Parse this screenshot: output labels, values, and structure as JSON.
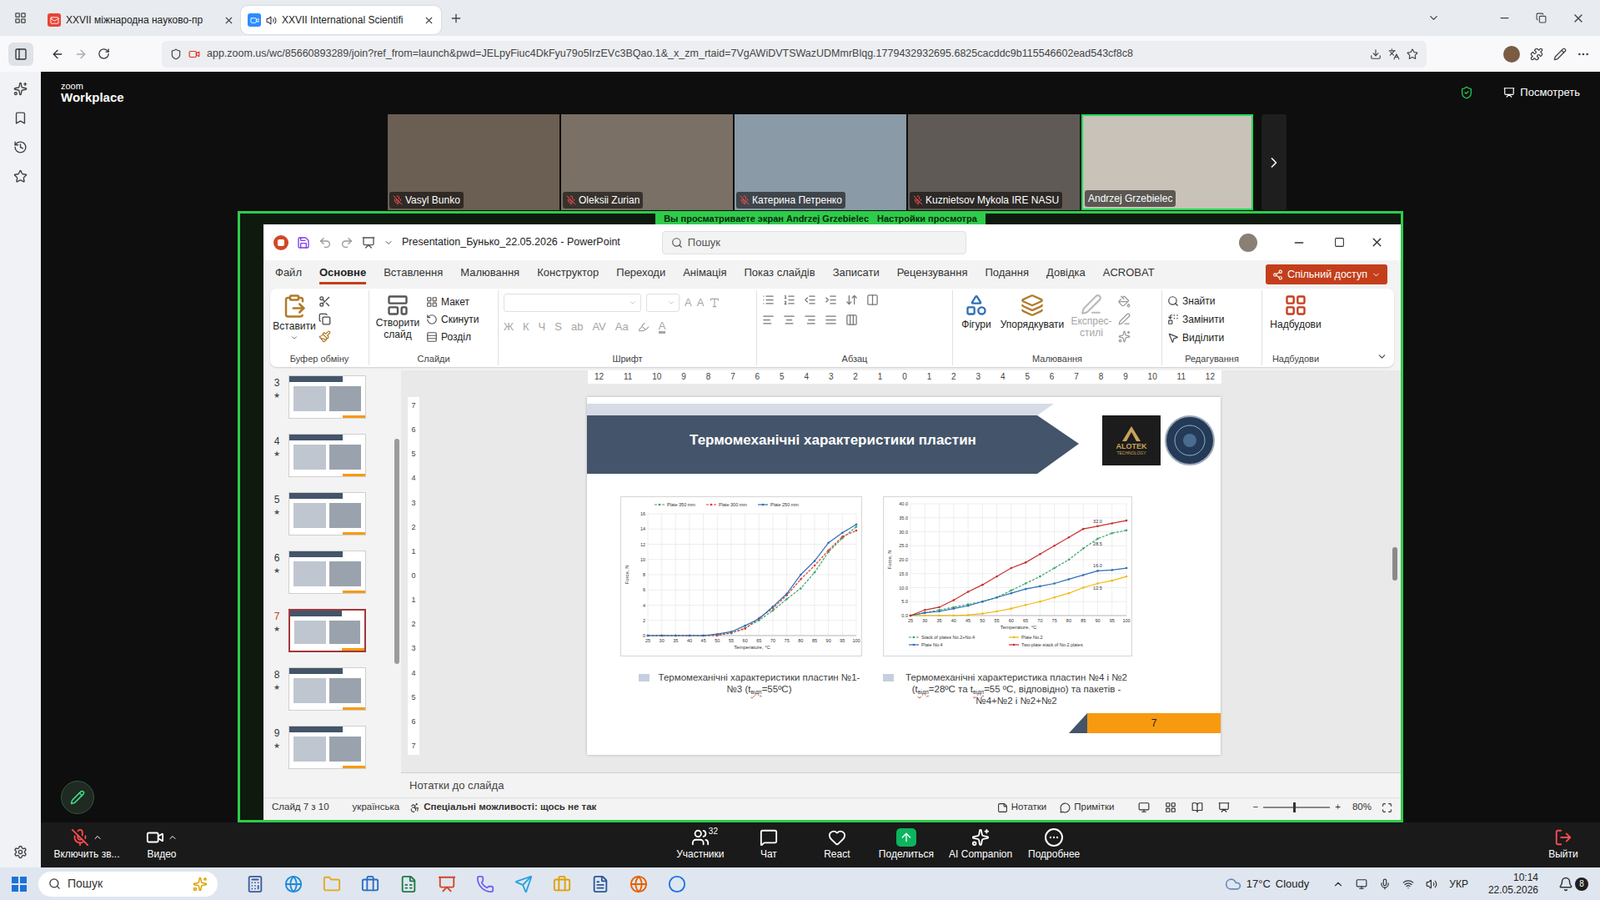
{
  "browser": {
    "tabs": [
      {
        "label": "XXVII міжнародна науково-пр",
        "selected": false,
        "color": "#ea4335",
        "audio": false
      },
      {
        "label": "XXVII International Scientifi",
        "selected": true,
        "color": "#2d8cff",
        "audio": true
      }
    ],
    "url": "app.zoom.us/wc/85660893289/join?ref_from=launch&pwd=JELpyFiuc4DkFyu79o5IrzEVc3BQao.1&_x_zm_rtaid=7VgAWiDVTSWazUDMmrBlqg.1779432932695.6825cacddc9b115546602ead543cf8c8"
  },
  "zoom": {
    "brand": "zoom",
    "product": "Workplace",
    "view_label": "Посмотреть",
    "participants": [
      {
        "name": "Vasyl Bunko",
        "muted": true,
        "active": false
      },
      {
        "name": "Oleksii Zurian",
        "muted": true,
        "active": false
      },
      {
        "name": "Катерина Петренко",
        "muted": true,
        "active": false
      },
      {
        "name": "Kuznietsov Mykola IRE NASU",
        "muted": true,
        "active": false
      },
      {
        "name": "Andrzej Grzebielec",
        "muted": false,
        "active": true
      }
    ],
    "banner": {
      "text": "Вы просматриваете экран  Andrzej Grzebielec",
      "settings": "Настройки просмотра"
    },
    "toolbar": {
      "mic": {
        "label": "Включить зв...",
        "muted": true
      },
      "video": {
        "label": "Видео"
      },
      "center": [
        {
          "label": "Участники",
          "kind": "participants",
          "badge": "32"
        },
        {
          "label": "Чат",
          "kind": "chat",
          "badge": ""
        },
        {
          "label": "React",
          "kind": "react",
          "badge": ""
        },
        {
          "label": "Поделиться",
          "kind": "share",
          "badge": ""
        },
        {
          "label": "AI Companion",
          "kind": "ai",
          "badge": ""
        },
        {
          "label": "Подробнее",
          "kind": "more",
          "badge": ""
        }
      ],
      "exit": "Выйти"
    }
  },
  "powerpoint": {
    "title": "Presentation_Бунько_22.05.2026  -  PowerPoint",
    "search": "Пошук",
    "tabs": [
      {
        "label": "Файл",
        "selected": false
      },
      {
        "label": "Основне",
        "selected": true
      },
      {
        "label": "Вставлення",
        "selected": false
      },
      {
        "label": "Малювання",
        "selected": false
      },
      {
        "label": "Конструктор",
        "selected": false
      },
      {
        "label": "Переходи",
        "selected": false
      },
      {
        "label": "Анімація",
        "selected": false
      },
      {
        "label": "Показ слайдів",
        "selected": false
      },
      {
        "label": "Записати",
        "selected": false
      },
      {
        "label": "Рецензування",
        "selected": false
      },
      {
        "label": "Подання",
        "selected": false
      },
      {
        "label": "Довідка",
        "selected": false
      },
      {
        "label": "ACROBAT",
        "selected": false
      }
    ],
    "share": "Спільний доступ",
    "ribbon": {
      "clipboard": {
        "label": "Буфер обміну",
        "paste": "Вставити"
      },
      "slides": {
        "label": "Слайди",
        "new": "Створити слайд",
        "layout": "Макет",
        "reset": "Скинути",
        "section": "Розділ"
      },
      "font": {
        "label": "Шрифт",
        "disabled": true,
        "size_buttons": [
          "A",
          "A"
        ],
        "buttons": [
          "Ж",
          "К",
          "Ч",
          "S",
          "ab",
          "AV",
          "Aa"
        ],
        "color_button": "A"
      },
      "paragraph": {
        "label": "Абзац"
      },
      "drawing": {
        "label": "Малювання",
        "shapes": "Фігури",
        "arrange": "Упорядкувати",
        "styles": "Експрес-стилі",
        "styles_disabled": true
      },
      "editing": {
        "label": "Редагування",
        "find": "Знайти",
        "replace": "Замінити",
        "select": "Виділити"
      },
      "addins": {
        "label": "Надбудови",
        "button": "Надбудови"
      }
    },
    "thumbnails": [
      {
        "number": "3",
        "mark": "★",
        "selected": false
      },
      {
        "number": "4",
        "mark": "★",
        "selected": false
      },
      {
        "number": "5",
        "mark": "★",
        "selected": false
      },
      {
        "number": "6",
        "mark": "★",
        "selected": false
      },
      {
        "number": "7",
        "mark": "★",
        "selected": true
      },
      {
        "number": "8",
        "mark": "★",
        "selected": false
      },
      {
        "number": "9",
        "mark": "★",
        "selected": false
      }
    ],
    "ruler_h": [
      "12",
      "11",
      "10",
      "9",
      "8",
      "7",
      "6",
      "5",
      "4",
      "3",
      "2",
      "1",
      "0",
      "1",
      "2",
      "3",
      "4",
      "5",
      "6",
      "7",
      "8",
      "9",
      "10",
      "11",
      "12"
    ],
    "ruler_v": [
      "7",
      "6",
      "5",
      "4",
      "3",
      "2",
      "1",
      "0",
      "1",
      "2",
      "3",
      "4",
      "5",
      "6",
      "7"
    ],
    "slide": {
      "title": "Термомеханічні характеристики пластин",
      "logo": {
        "name": "ALOTEK",
        "sub": "TECHNOLOGY"
      },
      "number": "7",
      "charts": [
        {
          "legend_position": "top",
          "y_title": "Force, N",
          "x_title": "Temperature, °C",
          "y_max": 16,
          "y_ticks": [
            "0",
            "2",
            "4",
            "6",
            "8",
            "10",
            "12",
            "14",
            "16"
          ],
          "x_labels": [
            "25",
            "30",
            "35",
            "40",
            "45",
            "50",
            "55",
            "60",
            "65",
            "70",
            "75",
            "80",
            "85",
            "90",
            "95",
            "100"
          ],
          "series": [
            {
              "name": "Plate 350 mm",
              "color": "#3aa76d",
              "kind": "dashed",
              "values": [
                0,
                0,
                0,
                0,
                0,
                0.1,
                0.3,
                1.0,
                2.0,
                3.3,
                4.8,
                6.2,
                8.3,
                11.0,
                12.8,
                14.3
              ]
            },
            {
              "name": "Plate 300 mm",
              "color": "#e03c31",
              "kind": "dashed",
              "values": [
                0,
                0,
                0,
                0,
                0,
                0,
                0.4,
                0.9,
                2.3,
                3.6,
                5.3,
                7.4,
                9.2,
                11.2,
                13.0,
                13.8
              ]
            },
            {
              "name": "Plate 250 mm",
              "color": "#2e6fb5",
              "kind": "solid",
              "values": [
                0,
                0,
                0,
                0,
                0,
                0.2,
                0.5,
                1.3,
                2.2,
                3.8,
                5.5,
                8.0,
                9.8,
                12.2,
                13.5,
                14.6
              ]
            }
          ],
          "annotations": [],
          "caption": [
            {
              "text": "Термомеханічні характеристики пластин №1-№3 (t",
              "sub": false
            },
            {
              "text": "відп",
              "sub": true
            },
            {
              "text": "=55ºС)",
              "sub": false
            }
          ]
        },
        {
          "legend_position": "bottom",
          "y_title": "Force, N",
          "x_title": "Temperature, °C",
          "y_max": 40,
          "y_ticks": [
            "0.0",
            "5.0",
            "10.0",
            "15.0",
            "20.0",
            "25.0",
            "30.0",
            "35.0",
            "40.0"
          ],
          "x_labels": [
            "25",
            "30",
            "35",
            "40",
            "45",
            "50",
            "55",
            "60",
            "65",
            "70",
            "75",
            "80",
            "85",
            "90",
            "95",
            "100"
          ],
          "series": [
            {
              "name": "Stack of plates No.2+No.4",
              "color": "#3aa76d",
              "kind": "dashed",
              "values": [
                0,
                1,
                2,
                3,
                4,
                5,
                6.5,
                9,
                11.5,
                14,
                17,
                20,
                24,
                27.5,
                29.5,
                30.5
              ]
            },
            {
              "name": "Plate No.2",
              "color": "#f2b705",
              "kind": "solid",
              "values": [
                0,
                0,
                0,
                0,
                0.2,
                0.7,
                1.5,
                2.5,
                3.8,
                5,
                6.5,
                8,
                10,
                11.5,
                12.5,
                14
              ]
            },
            {
              "name": "Plate No.4",
              "color": "#2e6fb5",
              "kind": "solid",
              "values": [
                0,
                1,
                1.5,
                2.5,
                3.5,
                5,
                6.5,
                8,
                9.5,
                10.5,
                11.5,
                13,
                14.5,
                16,
                16.3,
                17
              ]
            },
            {
              "name": "Two-plate stack of No.2 plates",
              "color": "#c9302c",
              "kind": "solid",
              "values": [
                0,
                2,
                3,
                5.5,
                8.5,
                11,
                14,
                17,
                19,
                22,
                25,
                28,
                31,
                32,
                33,
                34
              ]
            }
          ],
          "annotations": [
            {
              "label": "32.0",
              "series": 3,
              "point": 13,
              "above": true
            },
            {
              "label": "28.5",
              "series": 0,
              "point": 13,
              "above": false
            },
            {
              "label": "16.0",
              "series": 2,
              "point": 13,
              "above": true
            },
            {
              "label": "12.5",
              "series": 1,
              "point": 13,
              "above": false
            }
          ],
          "caption": [
            {
              "text": "Термомеханічні характеристика пластин №4 і №2 (t",
              "sub": false
            },
            {
              "text": "відп",
              "sub": true
            },
            {
              "text": "=28ºС та t",
              "sub": false
            },
            {
              "text": "відп",
              "sub": true
            },
            {
              "text": "=55 ºС, відповідно) та пакетів - №4+№2 і №2+№2",
              "sub": false
            }
          ]
        }
      ]
    },
    "notes": "Нотатки до слайда",
    "status": {
      "slide": "Слайд 7 з 10",
      "language": "українська",
      "accessibility": "Спеціальні можливості: щось не так",
      "notes": "Нотатки",
      "comments": "Примітки",
      "zoom": "80%",
      "zoom_level": 0.45,
      "minus": "−",
      "plus": "+"
    }
  },
  "taskbar": {
    "search": "Пошук",
    "weather": {
      "temp": "17°C",
      "desc": "Cloudy"
    },
    "lang": "УКР",
    "time": "10:14",
    "date": "22.05.2026",
    "notifications": "8"
  }
}
